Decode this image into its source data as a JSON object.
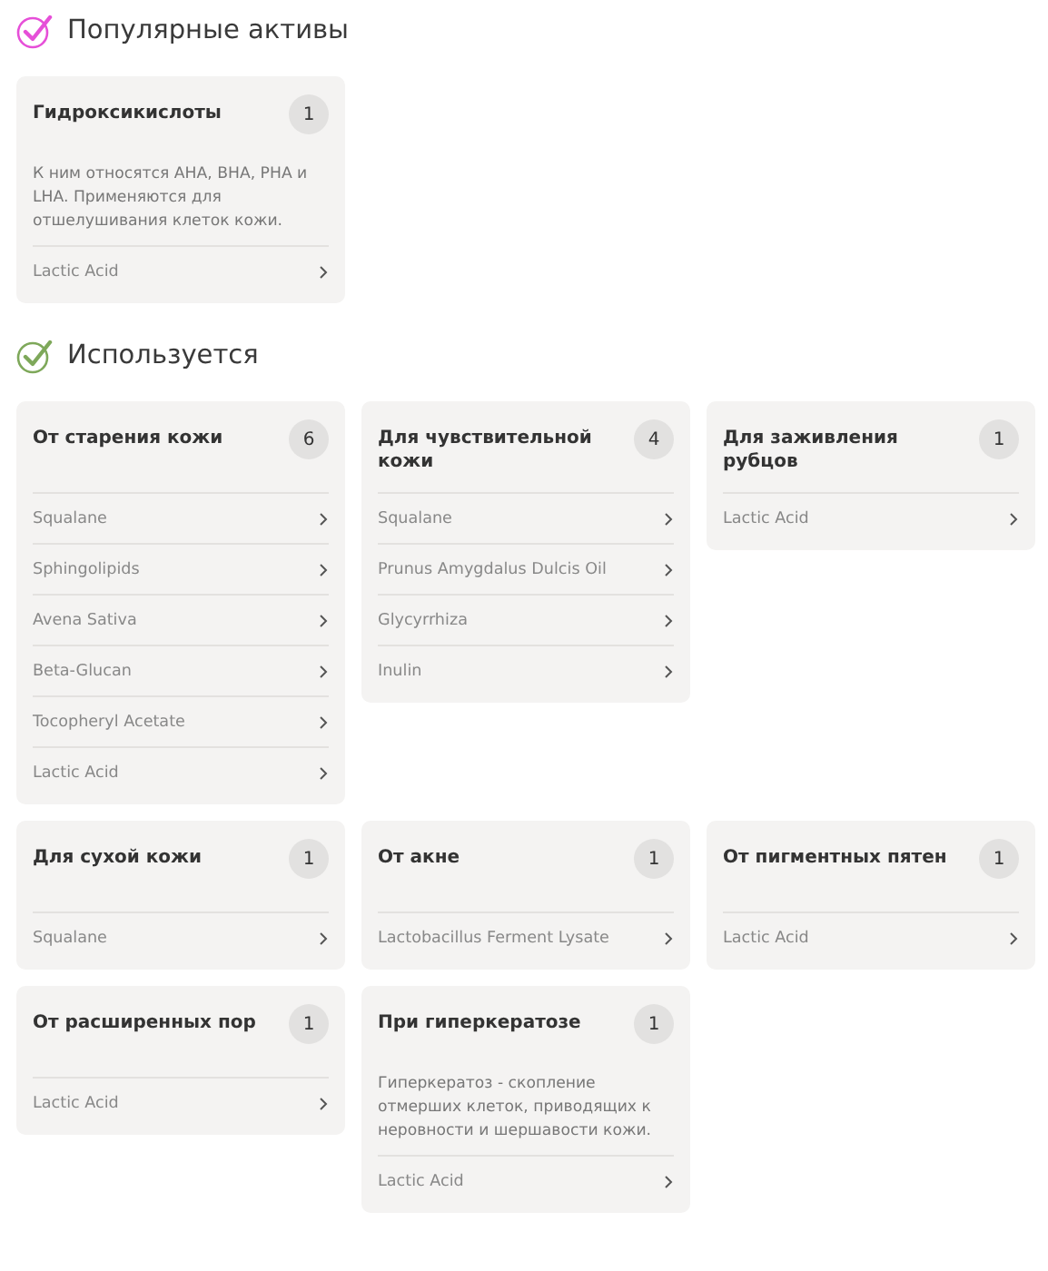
{
  "sections": [
    {
      "title": "Популярные активы",
      "color": "#e64fd8",
      "cards": [
        {
          "title": "Гидроксикислоты",
          "count": "1",
          "description": "К ним относятся AHA, BHA, PHA и LHA. Применяются для отшелушивания клеток кожи.",
          "items": [
            "Lactic Acid"
          ]
        }
      ]
    },
    {
      "title": "Используется",
      "color": "#7ea85a",
      "cards": [
        {
          "title": "От старения кожи",
          "count": "6",
          "items": [
            "Squalane",
            "Sphingolipids",
            "Avena Sativa",
            "Beta-Glucan",
            "Tocopheryl Acetate",
            "Lactic Acid"
          ]
        },
        {
          "title": "Для чувствительной кожи",
          "count": "4",
          "items": [
            "Squalane",
            "Prunus Amygdalus Dulcis Oil",
            "Glycyrrhiza",
            "Inulin"
          ]
        },
        {
          "title": "Для заживления рубцов",
          "count": "1",
          "items": [
            "Lactic Acid"
          ]
        },
        {
          "title": "Для сухой кожи",
          "count": "1",
          "items": [
            "Squalane"
          ]
        },
        {
          "title": "От акне",
          "count": "1",
          "items": [
            "Lactobacillus Ferment Lysate"
          ]
        },
        {
          "title": "От пигментных пятен",
          "count": "1",
          "items": [
            "Lactic Acid"
          ]
        },
        {
          "title": "От расширенных пор",
          "count": "1",
          "items": [
            "Lactic Acid"
          ]
        },
        {
          "title": "При гиперкератозе",
          "count": "1",
          "description": "Гиперкератоз - скопление отмерших клеток, приводящих к неровности и шершавости кожи.",
          "items": [
            "Lactic Acid"
          ]
        }
      ]
    }
  ]
}
